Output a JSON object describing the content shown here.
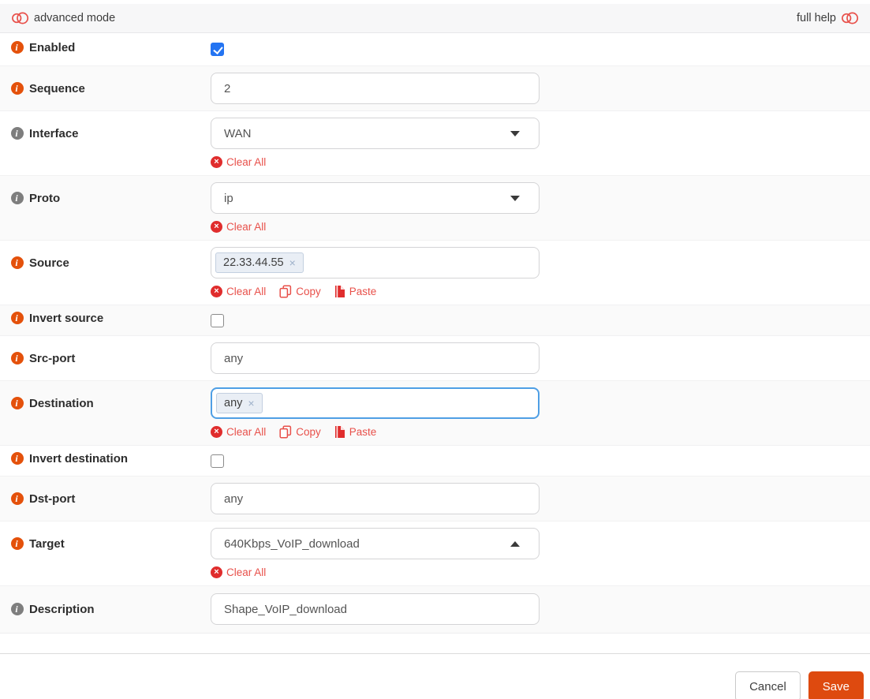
{
  "header": {
    "advanced_mode_label": "advanced mode",
    "full_help_label": "full help"
  },
  "icons": {
    "info": "i",
    "clear": "×",
    "token_remove": "×"
  },
  "colors": {
    "accent_orange": "#E4510B",
    "info_gray": "#7E7E7E",
    "link_red": "#E8504A",
    "save_button_bg": "#DE4A0F",
    "checkbox_blue": "#2474F2",
    "focus_border_blue": "#4F9FE5",
    "row_stripe_bg": "#FAFAFA",
    "topbar_bg": "#F7F7F8"
  },
  "fields": {
    "enabled": {
      "label": "Enabled",
      "checked": true
    },
    "sequence": {
      "label": "Sequence",
      "value": "2"
    },
    "interface": {
      "label": "Interface",
      "value": "WAN",
      "clear_all": "Clear All"
    },
    "proto": {
      "label": "Proto",
      "value": "ip",
      "clear_all": "Clear All"
    },
    "source": {
      "label": "Source",
      "token": "22.33.44.55",
      "clear_all": "Clear All",
      "copy": "Copy",
      "paste": "Paste"
    },
    "invert_source": {
      "label": "Invert source",
      "checked": false
    },
    "src_port": {
      "label": "Src-port",
      "value": "any"
    },
    "destination": {
      "label": "Destination",
      "token": "any",
      "focused": true,
      "clear_all": "Clear All",
      "copy": "Copy",
      "paste": "Paste"
    },
    "invert_destination": {
      "label": "Invert destination",
      "checked": false
    },
    "dst_port": {
      "label": "Dst-port",
      "value": "any"
    },
    "target": {
      "label": "Target",
      "value": "640Kbps_VoIP_download",
      "clear_all": "Clear All"
    },
    "description": {
      "label": "Description",
      "value": "Shape_VoIP_download"
    }
  },
  "footer": {
    "cancel_label": "Cancel",
    "save_label": "Save"
  }
}
